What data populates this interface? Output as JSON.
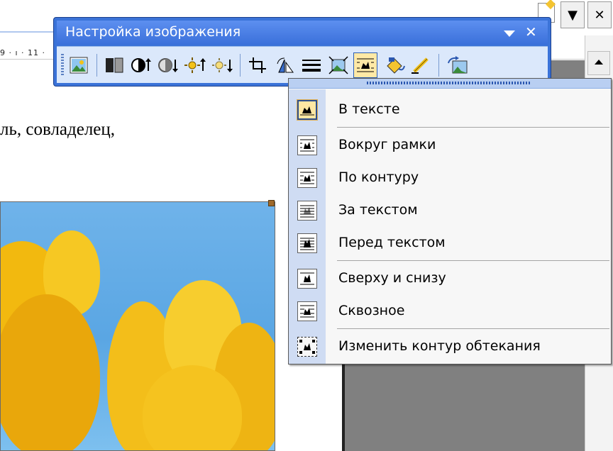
{
  "toolbar": {
    "title": "Настройка изображения",
    "buttons": [
      "insert-picture-icon",
      "color-icon",
      "more-contrast-icon",
      "less-contrast-icon",
      "more-brightness-icon",
      "less-brightness-icon",
      "crop-icon",
      "rotate-icon",
      "line-style-icon",
      "compress-icon",
      "text-wrapping-icon",
      "format-picture-icon",
      "set-transparent-color-icon",
      "reset-picture-icon"
    ]
  },
  "ruler": {
    "text": "9 · ı · 11 ·"
  },
  "document": {
    "text_line": "ль, совладелец,"
  },
  "menu": {
    "items": [
      {
        "label": "В тексте",
        "icon": "in-line-with-text-icon",
        "checked": true
      },
      {
        "label": "Вокруг рамки",
        "icon": "square-wrap-icon",
        "checked": false
      },
      {
        "label": "По контуру",
        "icon": "tight-wrap-icon",
        "checked": false
      },
      {
        "label": "За текстом",
        "icon": "behind-text-icon",
        "checked": false
      },
      {
        "label": "Перед текстом",
        "icon": "in-front-of-text-icon",
        "checked": false
      },
      {
        "label": "Сверху и снизу",
        "icon": "top-and-bottom-icon",
        "checked": false
      },
      {
        "label": "Сквозное",
        "icon": "through-wrap-icon",
        "checked": false
      },
      {
        "label": "Изменить контур обтекания",
        "icon": "edit-wrap-points-icon",
        "checked": false
      }
    ]
  },
  "colors": {
    "toolbar_title": "#3b73d8",
    "toolbar_body": "#dbe8fb",
    "menu_bg": "#f7f7f7",
    "menu_icon_column": "#cfdcf3",
    "checked_item": "#ffe7a3"
  }
}
